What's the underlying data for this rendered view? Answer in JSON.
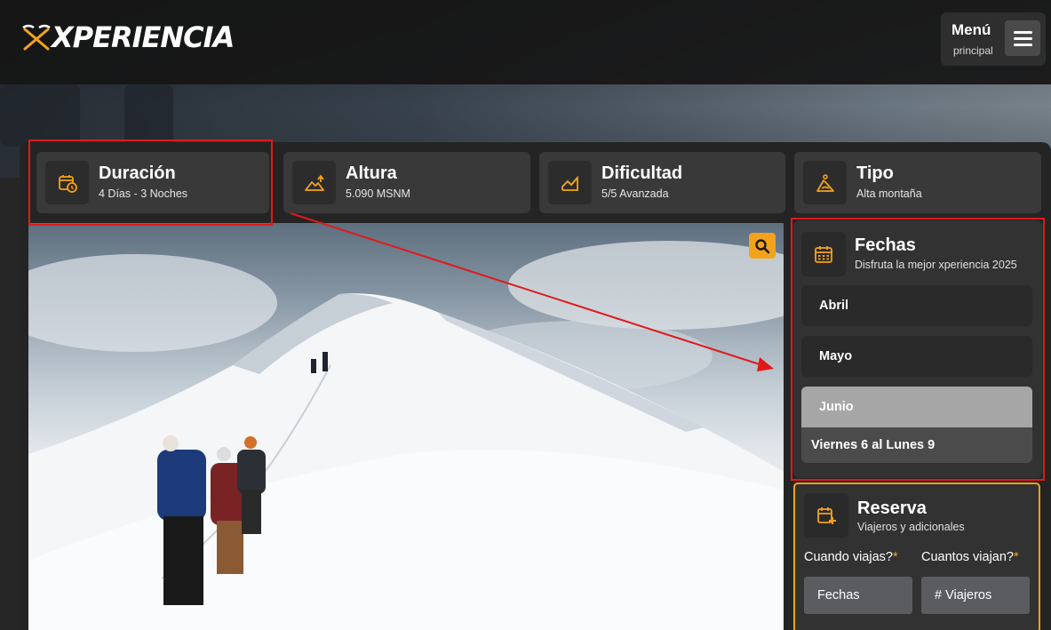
{
  "header": {
    "logo_text": "XPERIENCIA",
    "menu_label": "Menú",
    "menu_sub": "principal"
  },
  "stats": [
    {
      "title": "Duración",
      "sub": "4 Días - 3 Noches",
      "icon": "calendar-clock-icon"
    },
    {
      "title": "Altura",
      "sub": "5.090 MSNM",
      "icon": "mountain-up-icon"
    },
    {
      "title": "Dificultad",
      "sub": "5/5 Avanzada",
      "icon": "difficulty-chart-icon"
    },
    {
      "title": "Tipo",
      "sub": "Alta montaña",
      "icon": "climber-icon"
    }
  ],
  "fechas": {
    "title": "Fechas",
    "subtitle": "Disfruta la mejor xperiencia 2025",
    "months": [
      "Abril",
      "Mayo",
      "Junio"
    ],
    "selected_month": "Junio",
    "selected_dates": "Viernes 6 al Lunes 9"
  },
  "reserva": {
    "title": "Reserva",
    "subtitle": "Viajeros y adicionales",
    "when_label": "Cuando viajas?",
    "count_label": "Cuantos viajan?",
    "required_mark": "*",
    "when_value": "Fechas",
    "count_value": "# Viajeros"
  },
  "colors": {
    "accent": "#f5a21b",
    "annotation_red": "#e01a1a",
    "card_bg": "#393939",
    "page_bg": "#242424"
  }
}
